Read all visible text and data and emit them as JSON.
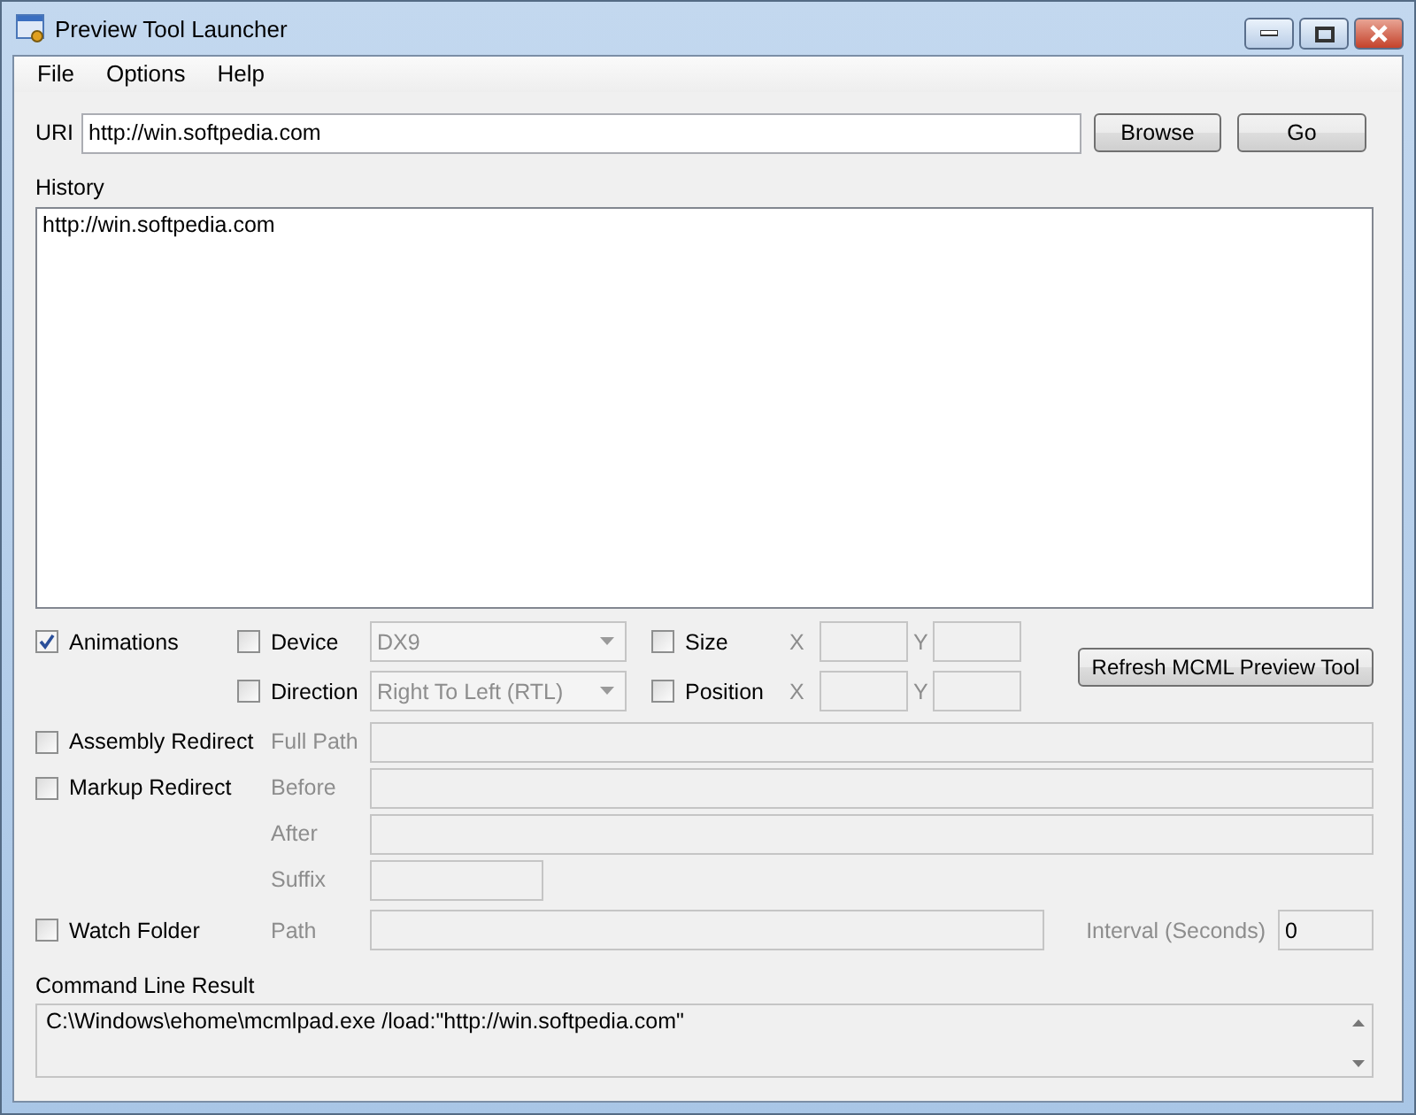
{
  "window": {
    "title": "Preview Tool Launcher"
  },
  "menu": [
    "File",
    "Options",
    "Help"
  ],
  "uri": {
    "label": "URI",
    "value": "http://win.softpedia.com"
  },
  "buttons": [
    "Browse",
    "Go"
  ],
  "history": {
    "label": "History",
    "items": [
      "http://win.softpedia.com"
    ]
  },
  "animations": {
    "label": "Animations",
    "checked": true
  },
  "device": {
    "label": "Device",
    "checked": false,
    "value": "DX9"
  },
  "direction": {
    "label": "Direction",
    "checked": false,
    "value": "Right To Left (RTL)"
  },
  "size": {
    "label": "Size",
    "checked": false,
    "x_label": "X",
    "y_label": "Y"
  },
  "position": {
    "label": "Position",
    "checked": false,
    "x_label": "X",
    "y_label": "Y"
  },
  "refresh_button": "Refresh MCML Preview Tool",
  "redirects": [
    {
      "label": "Assembly Redirect",
      "checked": false,
      "fields": [
        {
          "label": "Full Path",
          "kind": "wide"
        }
      ]
    },
    {
      "label": "Markup Redirect",
      "checked": false,
      "fields": [
        {
          "label": "Before",
          "kind": "wide"
        },
        {
          "label": "After",
          "kind": "wide"
        },
        {
          "label": "Suffix",
          "kind": "short"
        }
      ]
    }
  ],
  "watch_folder": {
    "label": "Watch Folder",
    "checked": false,
    "path_label": "Path",
    "interval_label": "Interval (Seconds)",
    "interval_value": "0"
  },
  "command_line": {
    "label": "Command Line Result",
    "value": "C:\\Windows\\ehome\\mcmlpad.exe /load:\"http://win.softpedia.com\""
  }
}
